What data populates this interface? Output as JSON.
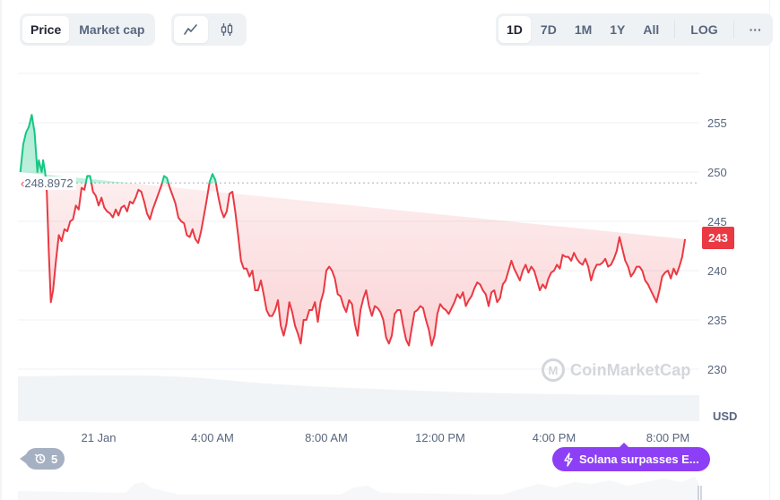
{
  "toolbar": {
    "type_tabs": [
      {
        "label": "Price",
        "active": true
      },
      {
        "label": "Market cap",
        "active": false
      }
    ],
    "view_buttons": [
      {
        "icon": "line-chart-icon",
        "active": true
      },
      {
        "icon": "candlestick-icon",
        "active": false
      }
    ],
    "range_tabs": [
      {
        "label": "1D",
        "active": true
      },
      {
        "label": "7D",
        "active": false
      },
      {
        "label": "1M",
        "active": false
      },
      {
        "label": "1Y",
        "active": false
      },
      {
        "label": "All",
        "active": false
      }
    ],
    "log_label": "LOG",
    "more_label": "···"
  },
  "reference_price_label": "248.8972",
  "current_price_label": "243",
  "currency_label": "USD",
  "watermark_text": "CoinMarketCap",
  "history_badge": {
    "icon": "history-icon",
    "count": "5"
  },
  "news_badge": {
    "icon": "lightning-icon",
    "text": "Solana surpasses E..."
  },
  "colors": {
    "up": "#16c784",
    "down": "#ea3943",
    "news": "#8d3ff5",
    "history": "#a6b0c3"
  },
  "chart_data": {
    "type": "line",
    "title": "",
    "xlabel": "",
    "ylabel": "USD",
    "ylim": [
      225.5,
      260
    ],
    "yticks": [
      255,
      250,
      245,
      240,
      235,
      230
    ],
    "xticks": [
      {
        "label": "21 Jan",
        "hour": 0
      },
      {
        "label": "4:00 AM",
        "hour": 4
      },
      {
        "label": "8:00 AM",
        "hour": 8
      },
      {
        "label": "12:00 PM",
        "hour": 12
      },
      {
        "label": "4:00 PM",
        "hour": 16
      },
      {
        "label": "8:00 PM",
        "hour": 20
      }
    ],
    "xlim_hours": [
      -2.8,
      21.2
    ],
    "grid": true,
    "reference_value": 248.8972,
    "current_value": 243,
    "series": [
      {
        "name": "Price",
        "hours": [
          -2.75,
          -2.65,
          -2.55,
          -2.45,
          -2.35,
          -2.25,
          -2.15,
          -2.1,
          -2.0,
          -1.95,
          -1.88,
          -1.82,
          -1.75,
          -1.68,
          -1.6,
          -1.5,
          -1.4,
          -1.3,
          -1.2,
          -1.1,
          -1.0,
          -0.9,
          -0.8,
          -0.7,
          -0.6,
          -0.5,
          -0.4,
          -0.3,
          -0.2,
          -0.1,
          0.0,
          0.1,
          0.2,
          0.3,
          0.4,
          0.5,
          0.6,
          0.7,
          0.8,
          0.9,
          1.0,
          1.1,
          1.2,
          1.3,
          1.4,
          1.5,
          1.6,
          1.7,
          1.8,
          1.9,
          2.0,
          2.1,
          2.2,
          2.3,
          2.4,
          2.5,
          2.6,
          2.7,
          2.8,
          2.9,
          3.0,
          3.1,
          3.2,
          3.3,
          3.4,
          3.5,
          3.6,
          3.7,
          3.8,
          3.9,
          4.0,
          4.1,
          4.2,
          4.3,
          4.4,
          4.5,
          4.6,
          4.7,
          4.8,
          4.9,
          5.0,
          5.1,
          5.2,
          5.3,
          5.4,
          5.5,
          5.6,
          5.7,
          5.8,
          5.9,
          6.0,
          6.1,
          6.2,
          6.3,
          6.4,
          6.5,
          6.6,
          6.7,
          6.8,
          6.9,
          7.0,
          7.1,
          7.2,
          7.3,
          7.4,
          7.5,
          7.6,
          7.7,
          7.8,
          7.9,
          8.0,
          8.1,
          8.2,
          8.3,
          8.4,
          8.5,
          8.6,
          8.7,
          8.8,
          8.9,
          9.0,
          9.1,
          9.2,
          9.3,
          9.4,
          9.5,
          9.6,
          9.7,
          9.8,
          9.9,
          10.0,
          10.1,
          10.2,
          10.3,
          10.4,
          10.5,
          10.6,
          10.7,
          10.8,
          10.9,
          11.0,
          11.1,
          11.2,
          11.3,
          11.4,
          11.5,
          11.6,
          11.7,
          11.8,
          11.9,
          12.0,
          12.1,
          12.2,
          12.3,
          12.4,
          12.5,
          12.6,
          12.7,
          12.8,
          12.9,
          13.0,
          13.1,
          13.2,
          13.3,
          13.4,
          13.5,
          13.6,
          13.7,
          13.8,
          13.9,
          14.0,
          14.1,
          14.2,
          14.3,
          14.4,
          14.5,
          14.6,
          14.7,
          14.8,
          14.9,
          15.0,
          15.1,
          15.2,
          15.3,
          15.4,
          15.5,
          15.6,
          15.7,
          15.8,
          15.9,
          16.0,
          16.1,
          16.2,
          16.3,
          16.4,
          16.5,
          16.6,
          16.7,
          16.8,
          16.9,
          17.0,
          17.1,
          17.2,
          17.3,
          17.4,
          17.5,
          17.6,
          17.7,
          17.8,
          17.9,
          18.0,
          18.1,
          18.2,
          18.3,
          18.4,
          18.5,
          18.6,
          18.7,
          18.8,
          18.9,
          19.0,
          19.1,
          19.2,
          19.3,
          19.4,
          19.5,
          19.6,
          19.7,
          19.8,
          19.9,
          20.0,
          20.1,
          20.2,
          20.3,
          20.4,
          20.5,
          20.6,
          20.7,
          20.8,
          20.9,
          21.0,
          21.1
        ],
        "values": [
          250.0,
          252.8,
          254.0,
          254.6,
          255.8,
          254.0,
          250.0,
          251.2,
          250.0,
          251.2,
          250.0,
          248.0,
          242.0,
          236.8,
          238.0,
          241.0,
          243.6,
          243.0,
          244.2,
          244.0,
          245.0,
          245.2,
          246.6,
          246.2,
          248.4,
          248.2,
          249.6,
          249.6,
          248.0,
          247.6,
          246.6,
          247.4,
          246.4,
          246.0,
          245.8,
          245.4,
          246.2,
          245.6,
          246.4,
          246.6,
          246.0,
          247.0,
          246.8,
          247.4,
          248.2,
          248.0,
          247.0,
          245.8,
          245.2,
          246.2,
          247.0,
          247.8,
          248.6,
          249.6,
          249.4,
          248.4,
          247.6,
          246.8,
          245.4,
          245.0,
          244.8,
          243.6,
          243.4,
          244.2,
          243.2,
          242.8,
          244.0,
          245.6,
          247.2,
          249.0,
          249.8,
          249.2,
          247.6,
          246.2,
          245.4,
          246.0,
          247.8,
          248.0,
          246.0,
          243.6,
          241.0,
          240.2,
          240.2,
          239.4,
          240.0,
          238.0,
          238.0,
          239.0,
          237.6,
          236.0,
          235.4,
          235.4,
          236.0,
          237.0,
          234.4,
          233.4,
          234.6,
          236.8,
          235.8,
          234.4,
          233.6,
          232.6,
          235.0,
          235.0,
          236.0,
          236.0,
          236.8,
          234.8,
          236.8,
          237.8,
          240.0,
          240.4,
          240.0,
          239.2,
          237.6,
          237.4,
          236.4,
          235.8,
          237.0,
          236.6,
          234.6,
          233.4,
          236.0,
          237.2,
          238.0,
          236.4,
          235.4,
          236.4,
          236.2,
          235.8,
          235.0,
          233.2,
          232.6,
          233.4,
          235.6,
          236.0,
          236.0,
          234.4,
          233.0,
          232.4,
          234.2,
          235.8,
          236.0,
          236.4,
          236.2,
          235.0,
          234.0,
          232.4,
          233.4,
          235.6,
          236.6,
          236.2,
          236.0,
          235.6,
          236.2,
          236.8,
          237.6,
          237.2,
          237.8,
          236.4,
          237.0,
          237.4,
          238.2,
          238.8,
          238.6,
          238.0,
          237.6,
          236.4,
          237.8,
          238.0,
          236.8,
          237.2,
          238.6,
          239.0,
          240.0,
          241.0,
          240.2,
          239.6,
          239.0,
          240.0,
          240.6,
          239.8,
          240.4,
          240.0,
          239.0,
          238.0,
          238.6,
          238.2,
          239.2,
          239.8,
          240.0,
          240.6,
          240.2,
          241.6,
          241.4,
          241.4,
          241.0,
          241.8,
          241.2,
          240.8,
          240.6,
          241.2,
          240.4,
          239.0,
          240.0,
          240.6,
          240.6,
          240.8,
          241.2,
          240.4,
          240.6,
          241.2,
          242.0,
          243.4,
          242.2,
          241.0,
          240.4,
          239.4,
          239.8,
          240.4,
          240.4,
          240.0,
          239.0,
          238.6,
          238.0,
          237.4,
          236.8,
          238.0,
          239.4,
          239.8,
          240.0,
          239.2,
          240.2,
          239.6,
          240.4,
          241.4,
          243.2
        ]
      }
    ]
  }
}
